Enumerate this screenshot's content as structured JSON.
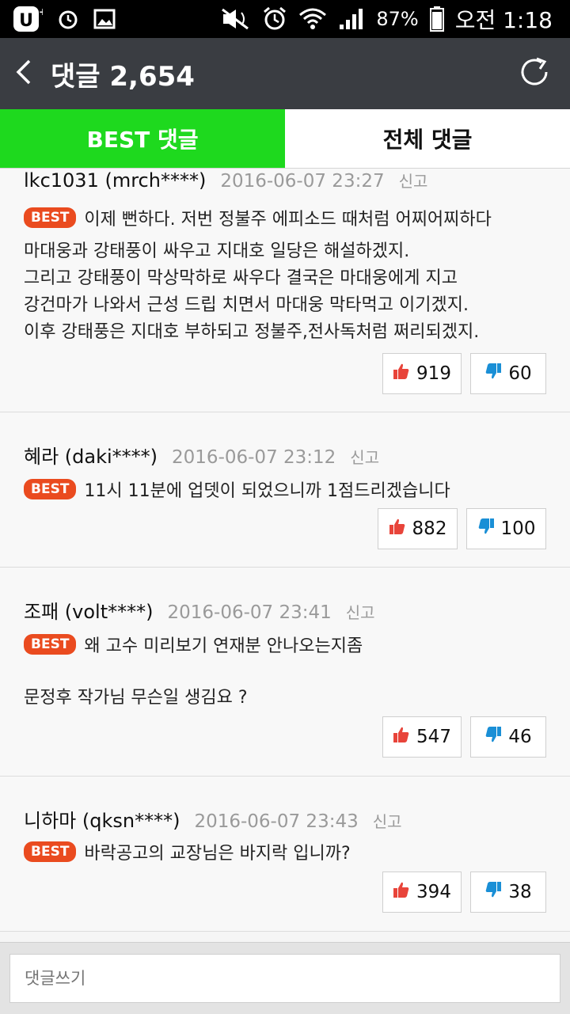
{
  "statusbar": {
    "battery": "87%",
    "time": "오전 1:18"
  },
  "appbar": {
    "title": "댓글 2,654"
  },
  "tabs": [
    {
      "label": "BEST 댓글"
    },
    {
      "label": "전체 댓글"
    }
  ],
  "badge_label": "BEST",
  "report_label": "신고",
  "comments": [
    {
      "author": "lkc1031 (mrch****)",
      "date": "2016-06-07 23:27",
      "best_text": "이제 뻔하다. 저번 정불주 에피소드 때처럼 어찌어찌하다",
      "body_lines": [
        "마대웅과 강태풍이 싸우고 지대호 일당은 해설하겠지.",
        "그리고 강태풍이 막상막하로 싸우다 결국은 마대웅에게 지고",
        "강건마가 나와서 근성 드립 치면서 마대웅 막타먹고 이기겠지.",
        "이후 강태풍은 지대호 부하되고 정불주,전사독처럼 쩌리되겠지."
      ],
      "likes": "919",
      "dislikes": "60"
    },
    {
      "author": "혜라 (daki****)",
      "date": "2016-06-07 23:12",
      "best_text": "11시 11분에 업뎃이 되었으니까 1점드리겠습니다",
      "body_lines": [],
      "likes": "882",
      "dislikes": "100"
    },
    {
      "author": "조패 (volt****)",
      "date": "2016-06-07 23:41",
      "best_text": "왜 고수 미리보기 연재분 안나오는지좀",
      "body_lines": [
        "문정후 작가님 무슨일 생김요 ?"
      ],
      "likes": "547",
      "dislikes": "46"
    },
    {
      "author": "니하마 (qksn****)",
      "date": "2016-06-07 23:43",
      "best_text": "바락공고의 교장님은 바지락 입니까?",
      "body_lines": [],
      "likes": "394",
      "dislikes": "38"
    }
  ],
  "input": {
    "placeholder": "댓글쓰기"
  },
  "colors": {
    "best_tab": "#1ed91e",
    "badge": "#ea4b1f",
    "like": "#e8443a",
    "dislike": "#1a8fd6",
    "appbar": "#3a3d42"
  },
  "icons": [
    "u-plus-icon",
    "alarm-clock-icon",
    "image-icon",
    "mute-icon",
    "alarm-icon",
    "wifi-icon",
    "signal-icon",
    "battery-icon",
    "back-icon",
    "refresh-icon",
    "thumbs-up-icon",
    "thumbs-down-icon"
  ]
}
